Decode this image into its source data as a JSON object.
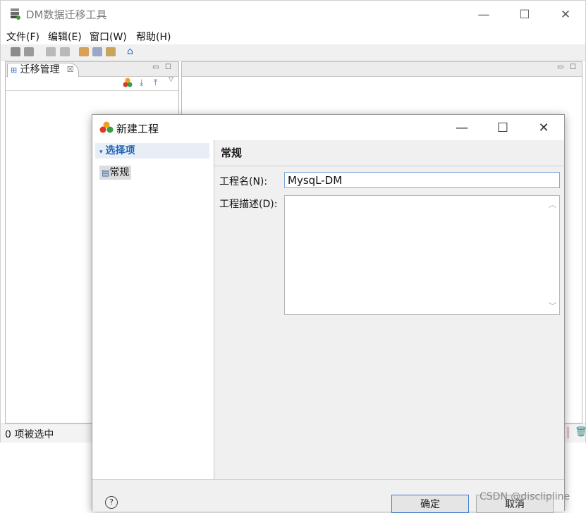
{
  "app": {
    "title": "DM数据迁移工具"
  },
  "window_controls": {
    "minimize": "—",
    "maximize": "☐",
    "close": "✕"
  },
  "menu": [
    "文件(F)",
    "编辑(E)",
    "窗口(W)",
    "帮助(H)"
  ],
  "toolbar_icons": [
    "save-icon",
    "save-all-icon",
    "undo-icon",
    "redo-icon",
    "cut-icon",
    "copy-icon",
    "paste-icon",
    "home-icon"
  ],
  "left_panel": {
    "tab_label": "迁移管理",
    "tab_close": "☒",
    "status": "0 项被选中"
  },
  "dialog": {
    "title": "新建工程",
    "left": {
      "section": "选择项",
      "items": [
        "常规"
      ]
    },
    "page_title": "常规",
    "fields": {
      "name_label": "工程名(N):",
      "name_value": "MysqL-DM",
      "desc_label": "工程描述(D):",
      "desc_value": ""
    },
    "buttons": {
      "ok": "确定",
      "cancel": "取消",
      "help": "?"
    }
  },
  "watermark": "CSDN @disclipline",
  "colors": {
    "accent": "#1d63b5",
    "input_border": "#7aa7d8"
  }
}
